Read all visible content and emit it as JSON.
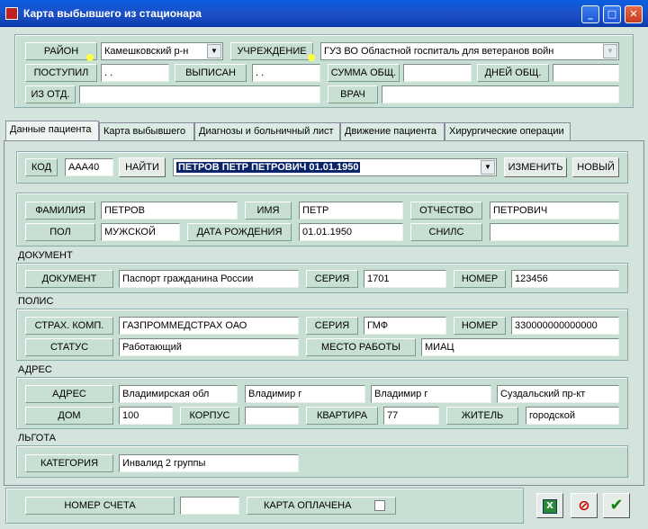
{
  "window": {
    "title": "Карта выбывшего из стационара"
  },
  "header": {
    "rayon_label": "РАЙОН",
    "rayon_value": "Камешковский р-н",
    "uchrezhdenie_label": "УЧРЕЖДЕНИЕ",
    "uchrezhdenie_value": "ГУЗ ВО Областной госпиталь для ветеранов войн",
    "postupil_label": "ПОСТУПИЛ",
    "postupil_value": " . .",
    "vypisan_label": "ВЫПИСАН",
    "vypisan_value": " . .",
    "summa_label": "СУММА ОБЩ.",
    "summa_value": "",
    "dney_label": "ДНЕЙ ОБЩ.",
    "dney_value": "",
    "iz_otd_label": "ИЗ ОТД.",
    "iz_otd_value": "",
    "vrach_label": "ВРАЧ",
    "vrach_value": ""
  },
  "tabs": [
    "Данные пациента",
    "Карта выбывшего",
    "Диагнозы и больничный лист",
    "Движение пациента",
    "Хирургические операции"
  ],
  "search": {
    "kod_label": "КОД",
    "kod_value": "ААА40",
    "find_label": "НАЙТИ",
    "patient_selected": "ПЕТРОВ  ПЕТР  ПЕТРОВИЧ  01.01.1950",
    "change_label": "ИЗМЕНИТЬ",
    "new_label": "НОВЫЙ"
  },
  "person": {
    "familiya_label": "ФАМИЛИЯ",
    "familiya_value": "ПЕТРОВ",
    "imya_label": "ИМЯ",
    "imya_value": "ПЕТР",
    "otchestvo_label": "ОТЧЕСТВО",
    "otchestvo_value": "ПЕТРОВИЧ",
    "pol_label": "ПОЛ",
    "pol_value": "МУЖСКОЙ",
    "dr_label": "ДАТА РОЖДЕНИЯ",
    "dr_value": "01.01.1950",
    "snils_label": "СНИЛС",
    "snils_value": ""
  },
  "document": {
    "section": "ДОКУМЕНТ",
    "doc_label": "ДОКУМЕНТ",
    "doc_value": "Паспорт гражданина России",
    "seriya_label": "СЕРИЯ",
    "seriya_value": "1701",
    "nomer_label": "НОМЕР",
    "nomer_value": "123456"
  },
  "polis": {
    "section": "ПОЛИС",
    "strah_label": "СТРАХ. КОМП.",
    "strah_value": "ГАЗПРОММЕДСТРАХ ОАО",
    "seriya_label": "СЕРИЯ",
    "seriya_value": "ГМФ",
    "nomer_label": "НОМЕР",
    "nomer_value": "330000000000000",
    "status_label": "СТАТУС",
    "status_value": "Работающий",
    "mesto_label": "МЕСТО РАБОТЫ",
    "mesto_value": "МИАЦ"
  },
  "address": {
    "section": "АДРЕС",
    "adres_label": "АДРЕС",
    "oblast": "Владимирская обл",
    "gorod": "Владимир г",
    "nasel": "Владимир г",
    "ulica": "Суздальский пр-кт",
    "dom_label": "ДОМ",
    "dom_value": "100",
    "korpus_label": "КОРПУС",
    "korpus_value": "",
    "kvartira_label": "КВАРТИРА",
    "kvartira_value": "77",
    "zhitel_label": "ЖИТЕЛЬ",
    "zhitel_value": "городской"
  },
  "lgota": {
    "section": "ЛЬГОТА",
    "kategoriya_label": "КАТЕГОРИЯ",
    "kategoriya_value": "Инвалид 2 группы"
  },
  "footer": {
    "schet_label": "НОМЕР СЧЕТА",
    "schet_value": "",
    "oplachena_label": "КАРТА ОПЛАЧЕНА",
    "ok_icon": "check-icon",
    "cancel_icon": "no-entry-icon",
    "excel_icon": "excel-icon"
  }
}
